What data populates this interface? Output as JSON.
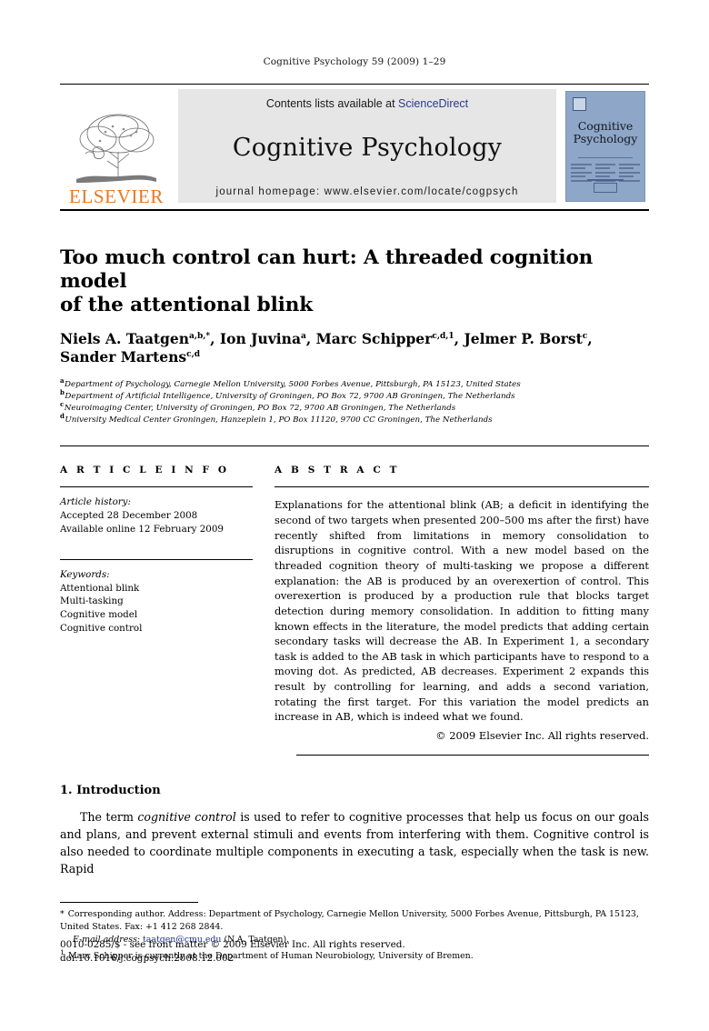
{
  "running_head": "Cognitive Psychology 59 (2009) 1–29",
  "masthead": {
    "publisher_logo_text": "ELSEVIER",
    "contents_prefix": "Contents lists available at ",
    "contents_link": "ScienceDirect",
    "journal_name": "Cognitive Psychology",
    "homepage_line": "journal homepage: www.elsevier.com/locate/cogpsych",
    "cover_title_line1": "Cognitive",
    "cover_title_line2": "Psychology",
    "accent_orange": "#E87722",
    "link_blue": "#2b3a8f",
    "cover_blue": "#8ea6c8",
    "panel_grey": "#e6e6e6"
  },
  "article": {
    "title_line1": "Too much control can hurt: A threaded cognition model",
    "title_line2": "of the attentional blink",
    "authors": [
      {
        "name": "Niels A. Taatgen",
        "sup": "a,b,*",
        "sep": ", "
      },
      {
        "name": "Ion Juvina",
        "sup": "a",
        "sep": ", "
      },
      {
        "name": "Marc Schipper",
        "sup": "c,d,1",
        "sep": ", "
      },
      {
        "name": "Jelmer P. Borst",
        "sup": "c",
        "sep": ", "
      },
      {
        "name": "Sander Martens",
        "sup": "c,d",
        "sep": ""
      }
    ],
    "affiliations": [
      {
        "mark": "a",
        "text": "Department of Psychology, Carnegie Mellon University, 5000 Forbes Avenue, Pittsburgh, PA 15123, United States"
      },
      {
        "mark": "b",
        "text": "Department of Artificial Intelligence, University of Groningen, PO Box 72, 9700 AB Groningen, The Netherlands"
      },
      {
        "mark": "c",
        "text": "Neuroimaging Center, University of Groningen, PO Box 72, 9700 AB Groningen, The Netherlands"
      },
      {
        "mark": "d",
        "text": "University Medical Center Groningen, Hanzeplein 1, PO Box 11120, 9700 CC Groningen, The Netherlands"
      }
    ]
  },
  "article_info": {
    "heading": "A R T I C L E  I N F O",
    "history_label": "Article history:",
    "history_lines": [
      "Accepted 28 December 2008",
      "Available online 12 February 2009"
    ],
    "keywords_label": "Keywords:",
    "keywords": [
      "Attentional blink",
      "Multi-tasking",
      "Cognitive model",
      "Cognitive control"
    ]
  },
  "abstract": {
    "heading": "A B S T R A C T",
    "text": "Explanations for the attentional blink (AB; a deficit in identifying the second of two targets when presented 200–500 ms after the first) have recently shifted from limitations in memory consolidation to disruptions in cognitive control. With a new model based on the threaded cognition theory of multi-tasking we propose a different explanation: the AB is produced by an overexertion of control. This overexertion is produced by a production rule that blocks target detection during memory consolidation. In addition to fitting many known effects in the literature, the model predicts that adding certain secondary tasks will decrease the AB. In Experiment 1, a secondary task is added to the AB task in which participants have to respond to a moving dot. As predicted, AB decreases. Experiment 2 expands this result by controlling for learning, and adds a second variation, rotating the first target. For this variation the model predicts an increase in AB, which is indeed what we found.",
    "copyright": "© 2009 Elsevier Inc. All rights reserved."
  },
  "body": {
    "section_number_title": "1. Introduction",
    "paragraph_part1": "The term ",
    "paragraph_italic": "cognitive control",
    "paragraph_part2": " is used to refer to cognitive processes that help us focus on our goals and plans, and prevent external stimuli and events from interfering with them. Cognitive control is also needed to coordinate multiple components in executing a task, especially when the task is new. Rapid"
  },
  "footnotes": {
    "corresponding_mark": "*",
    "corresponding_text": "Corresponding author. Address: Department of Psychology, Carnegie Mellon University, 5000 Forbes Avenue, Pittsburgh, PA 15123, United States. Fax: +1 412 268 2844.",
    "email_label": "E-mail address:",
    "email_value": "taatgen@cmu.edu",
    "email_attrib": "(N.A. Taatgen).",
    "note1_mark": "1",
    "note1_text": "Marc Schipper is currently at the Department of Human Neurobiology, University of Bremen."
  },
  "imprint": {
    "line1": "0010-0285/$ - see front matter © 2009 Elsevier Inc. All rights reserved.",
    "line2": "doi:10.1016/j.cogpsych.2008.12.002"
  }
}
